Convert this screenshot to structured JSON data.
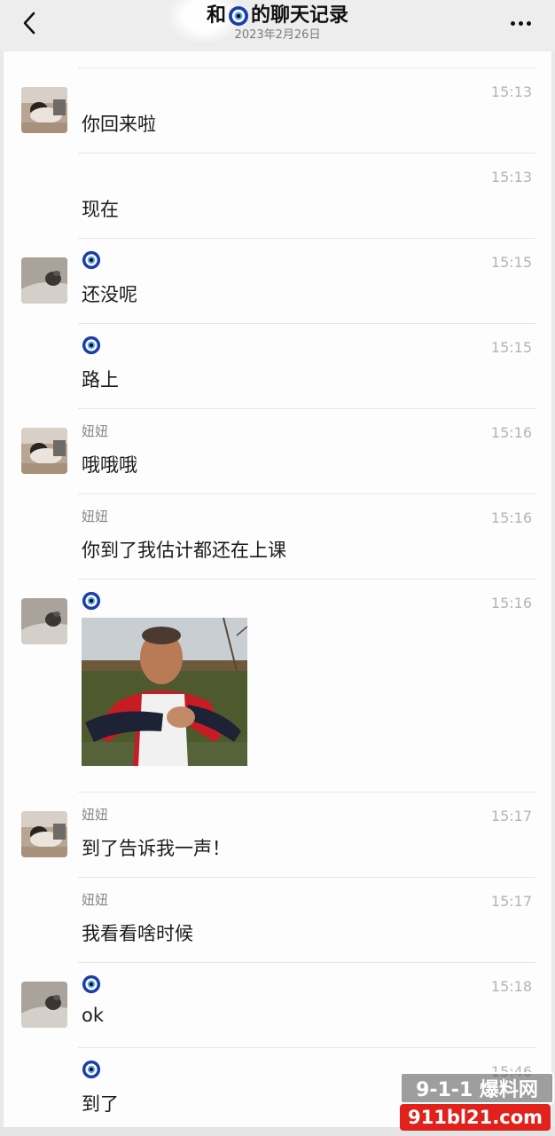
{
  "header": {
    "title_prefix": "和",
    "title_suffix": "的聊天记录",
    "date": "2023年2月26日"
  },
  "messages": [
    {
      "sender": "",
      "time": "15:13",
      "text": "你回来啦"
    },
    {
      "sender": "",
      "time": "15:13",
      "text": "现在"
    },
    {
      "sender": "🧿",
      "time": "15:15",
      "text": "还没呢"
    },
    {
      "sender": "🧿",
      "time": "15:15",
      "text": "路上"
    },
    {
      "sender": "妞妞",
      "time": "15:16",
      "text": "哦哦哦"
    },
    {
      "sender": "妞妞",
      "time": "15:16",
      "text": "你到了我估计都还在上课"
    },
    {
      "sender": "🧿",
      "time": "15:16",
      "text": ""
    },
    {
      "sender": "妞妞",
      "time": "15:17",
      "text": "到了告诉我一声！"
    },
    {
      "sender": "妞妞",
      "time": "15:17",
      "text": "我看看啥时候"
    },
    {
      "sender": "🧿",
      "time": "15:18",
      "text": "ok"
    },
    {
      "sender": "🧿",
      "time": "15:46",
      "text": "到了"
    }
  ],
  "watermark": {
    "top": "9-1-1 爆料网",
    "bottom": "911bl21.com"
  },
  "colors": {
    "nazar_blue": "#1a3fa8",
    "watermark_red": "#e0211c"
  }
}
